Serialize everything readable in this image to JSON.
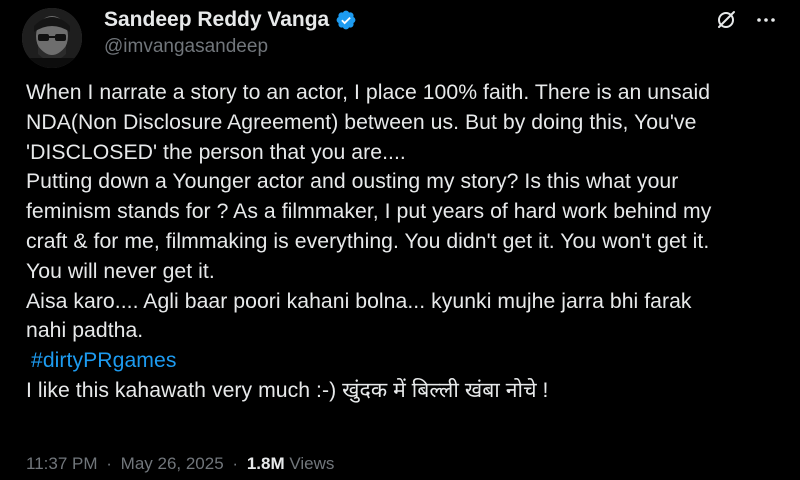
{
  "author": {
    "display_name": "Sandeep Reddy Vanga",
    "handle": "@imvangasandeep",
    "verified": true
  },
  "tweet": {
    "lines": [
      "When I narrate a story to an actor, I place 100% faith. There is an unsaid",
      "NDA(Non Disclosure Agreement) between us. But by doing this, You've",
      "'DISCLOSED' the person that you are....",
      "Putting down a Younger actor and ousting my story?  Is this what your",
      "feminism stands for ? As a filmmaker, I put years of hard work behind my",
      "craft & for me, filmmaking is everything. You didn't get it. You won't get it.",
      "You will never get it.",
      "Aisa karo.... Agli baar poori kahani bolna... kyunki mujhe jarra bhi farak",
      "nahi padtha."
    ],
    "hashtag": "#dirtyPRgames",
    "last_line": "I like this kahawath very much :-) खुंदक में बिल्ली खंबा नोचे !"
  },
  "meta": {
    "time": "11:37 PM",
    "separator": "·",
    "date": "May 26, 2025",
    "views_count": "1.8M",
    "views_label": "Views"
  },
  "icons": {
    "verified": "verified-badge-icon",
    "grok": "grok-icon",
    "more": "more-options-icon"
  },
  "colors": {
    "background": "#000000",
    "text": "#e7e9ea",
    "muted": "#71767b",
    "accent": "#1d9bf0"
  }
}
